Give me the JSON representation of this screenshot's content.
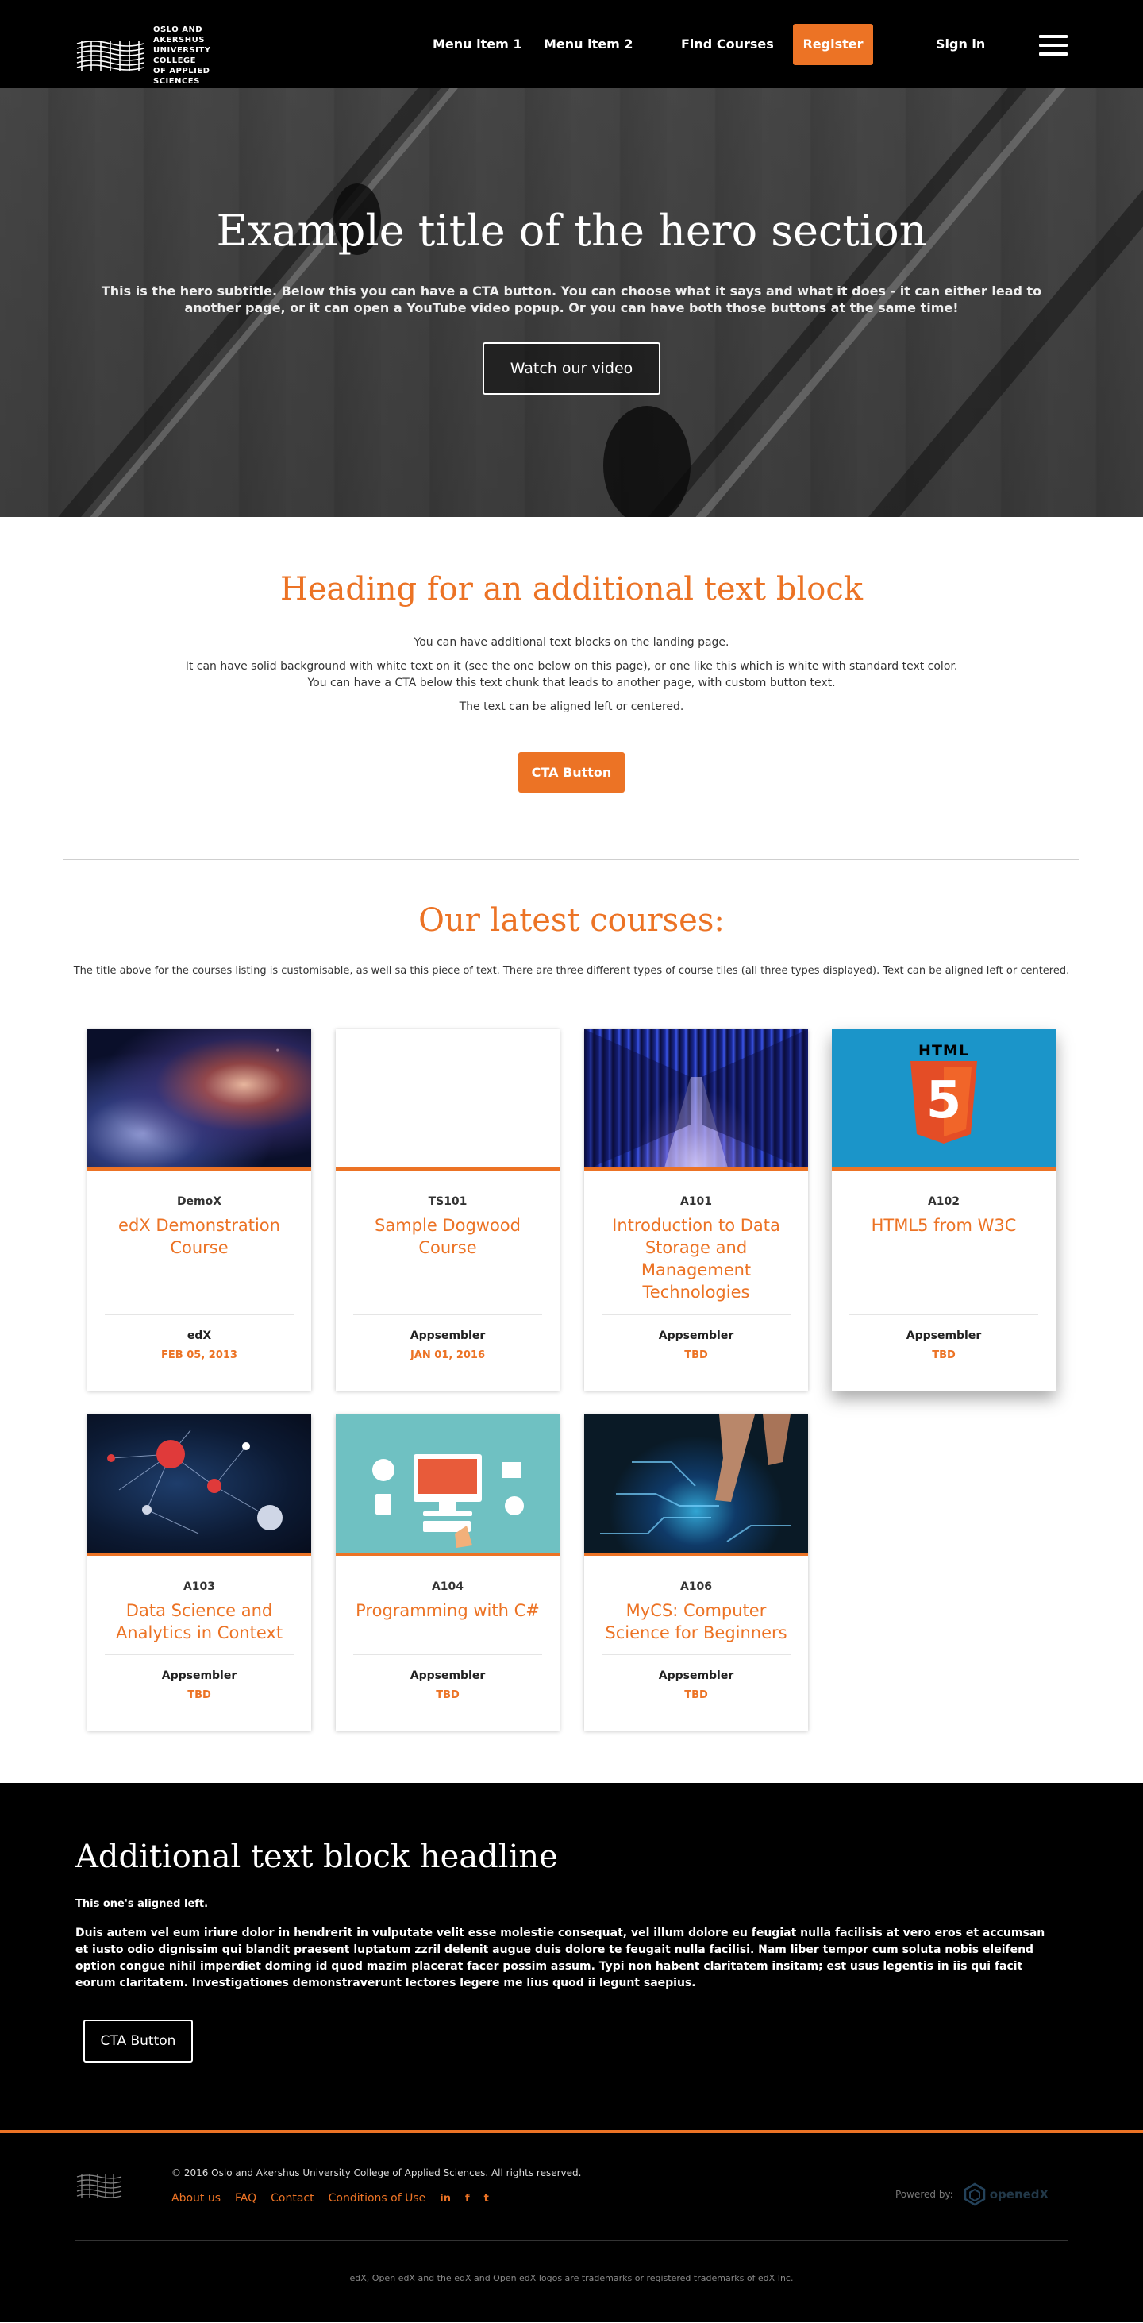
{
  "header": {
    "logo_lines": [
      "OSLO AND AKERSHUS",
      "UNIVERSITY COLLEGE",
      "OF APPLIED SCIENCES"
    ],
    "nav": [
      {
        "label": "Menu item 1"
      },
      {
        "label": "Menu item 2"
      },
      {
        "label": "Find Courses"
      }
    ],
    "register_label": "Register",
    "signin_label": "Sign in",
    "menu_icon": "hamburger-icon"
  },
  "hero": {
    "title": "Example title of the hero section",
    "subtitle": "This is the hero subtitle. Below this you can have a CTA button. You can choose what it says and what it does - it can either lead to another page, or it can open a YouTube video popup. Or you can have both those buttons at the same time!",
    "cta_label": "Watch our video"
  },
  "text_block": {
    "heading": "Heading for an additional text block",
    "line1": "You can have additional text blocks on the landing page.",
    "line2": "It can have solid background with white text on it (see the one below on this page), or one like this which is white with standard text color.",
    "line3": "You can have a CTA below this text chunk that leads to another page, with custom button text.",
    "line4": "The text can be aligned left or centered.",
    "cta_label": "CTA Button"
  },
  "courses": {
    "heading": "Our latest courses:",
    "description": "The title above for the courses listing is customisable, as well sa this piece of text. There are three different types of course tiles (all three types displayed). Text can be aligned left or centered.",
    "items": [
      {
        "code": "DemoX",
        "title": "edX Demonstration Course",
        "org": "edX",
        "date": "FEB 05, 2013",
        "image": "nebula"
      },
      {
        "code": "TS101",
        "title": "Sample Dogwood Course",
        "org": "Appsembler",
        "date": "JAN 01, 2016",
        "image": "blank"
      },
      {
        "code": "A101",
        "title": "Introduction to Data Storage and Management Technologies",
        "org": "Appsembler",
        "date": "TBD",
        "image": "server-room"
      },
      {
        "code": "A102",
        "title": "HTML5 from W3C",
        "org": "Appsembler",
        "date": "TBD",
        "image": "html5-logo"
      },
      {
        "code": "A103",
        "title": "Data Science and Analytics in Context",
        "org": "Appsembler",
        "date": "TBD",
        "image": "network-graph"
      },
      {
        "code": "A104",
        "title": "Programming with C#",
        "org": "Appsembler",
        "date": "TBD",
        "image": "computer-illustration"
      },
      {
        "code": "A106",
        "title": "MyCS: Computer Science for Beginners",
        "org": "Appsembler",
        "date": "TBD",
        "image": "circuit-hand"
      }
    ],
    "html5_badge": "HTML",
    "html5_number": "5"
  },
  "additional_block": {
    "headline": "Additional text block headline",
    "aligned_note": "This one's aligned left.",
    "paragraph": "Duis autem vel eum iriure dolor in hendrerit in vulputate velit esse molestie consequat, vel illum dolore eu feugiat nulla facilisis at vero eros et accumsan et iusto odio dignissim qui blandit praesent luptatum zzril delenit augue duis dolore te feugait nulla facilisi. Nam liber tempor cum soluta nobis eleifend option congue nihil imperdiet doming id quod mazim placerat facer possim assum. Typi non habent claritatem insitam; est usus legentis in iis qui facit eorum claritatem. Investigationes demonstraverunt lectores legere me lius quod ii legunt saepius.",
    "cta_label": "CTA Button"
  },
  "footer": {
    "copyright": "© 2016 Oslo and Akershus University College of Applied Sciences. All rights reserved.",
    "links": [
      {
        "label": "About us"
      },
      {
        "label": "FAQ"
      },
      {
        "label": "Contact"
      },
      {
        "label": "Conditions of Use"
      }
    ],
    "social": [
      "linkedin-icon",
      "facebook-icon",
      "twitter-icon"
    ],
    "social_glyphs": [
      "in",
      "f",
      "t"
    ],
    "powered_by": "Powered by:",
    "openedx_label": "openedX",
    "trademark": "edX, Open edX and the edX and Open edX logos are trademarks or registered trademarks of edX Inc."
  },
  "colors": {
    "accent": "#ec7325",
    "header_bg": "#000000",
    "html5_tile_bg": "#1b95c9"
  }
}
